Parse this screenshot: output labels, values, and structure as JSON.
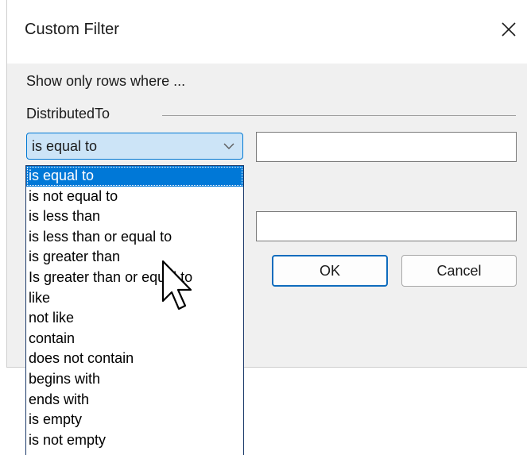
{
  "dialog": {
    "title": "Custom Filter",
    "close_icon": "close-icon",
    "prompt": "Show only rows where ...",
    "group_label": "DistributedTo",
    "condition1": {
      "operator": "is equal to",
      "value": ""
    },
    "condition2": {
      "value": ""
    },
    "ok_label": "OK",
    "cancel_label": "Cancel"
  },
  "dropdown": {
    "options": [
      "is equal to",
      "is not equal to",
      "is less than",
      "is less than or equal to",
      "is greater than",
      "Is greater than or equal to",
      "like",
      "not like",
      "contain",
      "does not contain",
      "begins with",
      "ends with",
      "is empty",
      "is not empty"
    ],
    "selected": "is equal to"
  },
  "colors": {
    "accent": "#0078d7",
    "combo_bg": "#cce4f7",
    "dialog_bg": "#f0f0f0"
  }
}
